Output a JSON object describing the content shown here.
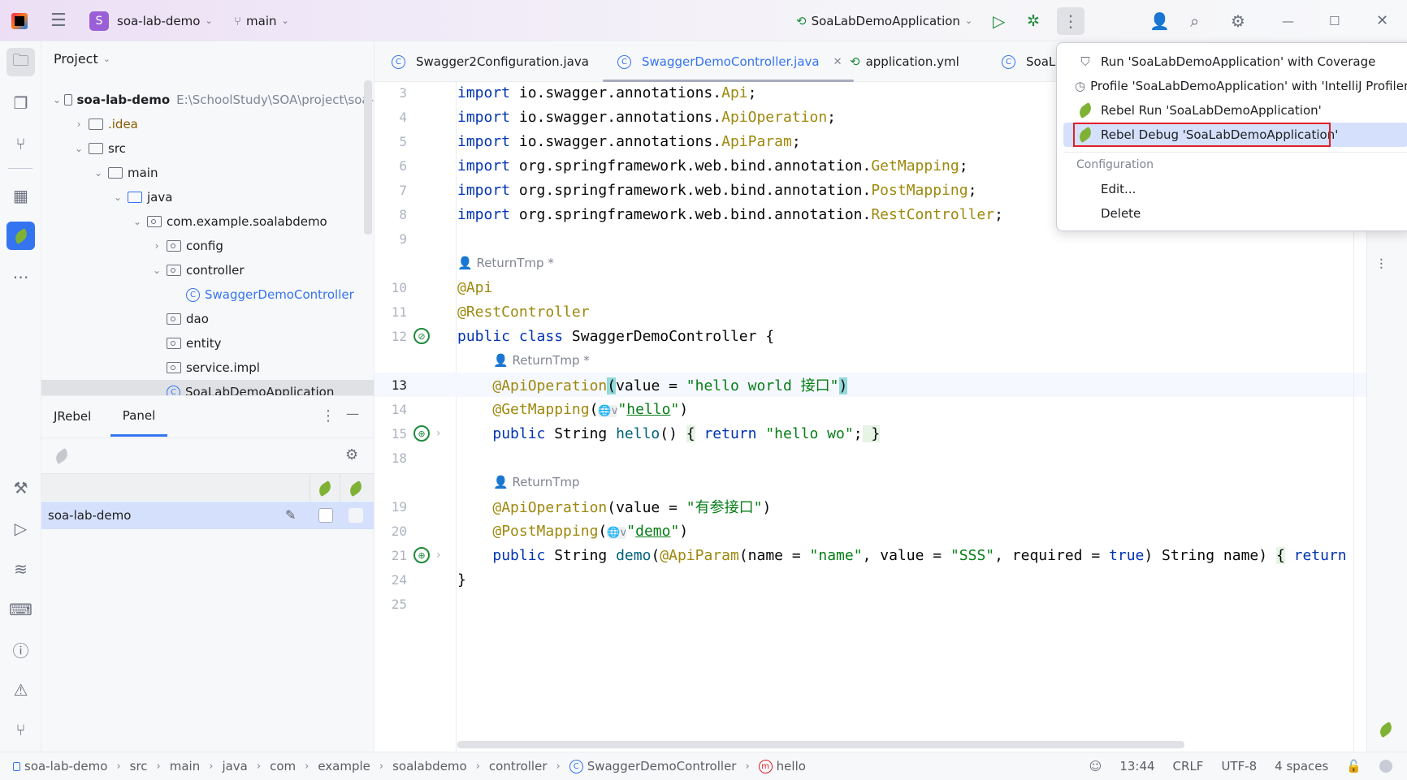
{
  "titlebar": {
    "project_initial": "S",
    "project_name": "soa-lab-demo",
    "branch": "main",
    "run_config": "SoaLabDemoApplication",
    "project_color": "#9a5fd6"
  },
  "project_panel": {
    "title": "Project",
    "tree": [
      {
        "label": "soa-lab-demo",
        "path": "E:\\SchoolStudy\\SOA\\project\\soa-",
        "depth": 0,
        "chev": "v",
        "icon": "module",
        "bold": true
      },
      {
        "label": ".idea",
        "depth": 1,
        "chev": ">",
        "icon": "folder",
        "color": "#8a5a00"
      },
      {
        "label": "src",
        "depth": 1,
        "chev": "v",
        "icon": "folder"
      },
      {
        "label": "main",
        "depth": 2,
        "chev": "v",
        "icon": "folder"
      },
      {
        "label": "java",
        "depth": 3,
        "chev": "v",
        "icon": "folder-blue"
      },
      {
        "label": "com.example.soalabdemo",
        "depth": 4,
        "chev": "v",
        "icon": "package"
      },
      {
        "label": "config",
        "depth": 5,
        "chev": ">",
        "icon": "package"
      },
      {
        "label": "controller",
        "depth": 5,
        "chev": "v",
        "icon": "package"
      },
      {
        "label": "SwaggerDemoController",
        "depth": 6,
        "chev": "",
        "icon": "class",
        "color": "#3574f0"
      },
      {
        "label": "dao",
        "depth": 5,
        "chev": "",
        "icon": "package"
      },
      {
        "label": "entity",
        "depth": 5,
        "chev": "",
        "icon": "package"
      },
      {
        "label": "service.impl",
        "depth": 5,
        "chev": "",
        "icon": "package"
      },
      {
        "label": "SoaLabDemoApplication",
        "depth": 5,
        "chev": "",
        "icon": "class"
      }
    ]
  },
  "jrebel_panel": {
    "tabs": [
      "JRebel",
      "Panel"
    ],
    "active_tab": "Panel",
    "row": {
      "name": "soa-lab-demo",
      "jrebel_enabled": false,
      "remote_enabled": false
    }
  },
  "editor": {
    "tabs": [
      {
        "label": "Swagger2Configuration.java",
        "active": false
      },
      {
        "label": "SwaggerDemoController.java",
        "active": true,
        "closable": true
      },
      {
        "label": "application.yml",
        "active": false
      },
      {
        "label": "SoaLa",
        "active": false
      }
    ],
    "lines": [
      {
        "n": "3",
        "t": [
          [
            "import ",
            "kw"
          ],
          [
            "io.swagger.annotations.",
            "pl"
          ],
          [
            "Api",
            "an"
          ],
          [
            ";",
            "pl"
          ]
        ]
      },
      {
        "n": "4",
        "t": [
          [
            "import ",
            "kw"
          ],
          [
            "io.swagger.annotations.",
            "pl"
          ],
          [
            "ApiOperation",
            "an"
          ],
          [
            ";",
            "pl"
          ]
        ]
      },
      {
        "n": "5",
        "t": [
          [
            "import ",
            "kw"
          ],
          [
            "io.swagger.annotations.",
            "pl"
          ],
          [
            "ApiParam",
            "an"
          ],
          [
            ";",
            "pl"
          ]
        ]
      },
      {
        "n": "6",
        "t": [
          [
            "import ",
            "kw"
          ],
          [
            "org.springframework.web.bind.annotation.",
            "pl"
          ],
          [
            "GetMapping",
            "an"
          ],
          [
            ";",
            "pl"
          ]
        ]
      },
      {
        "n": "7",
        "t": [
          [
            "import ",
            "kw"
          ],
          [
            "org.springframework.web.bind.annotation.",
            "pl"
          ],
          [
            "PostMapping",
            "an"
          ],
          [
            ";",
            "pl"
          ]
        ]
      },
      {
        "n": "8",
        "t": [
          [
            "import ",
            "kw"
          ],
          [
            "org.springframework.web.bind.annotation.",
            "pl"
          ],
          [
            "RestController",
            "an"
          ],
          [
            ";",
            "pl"
          ]
        ]
      },
      {
        "n": "9",
        "t": []
      },
      {
        "inlay": "ReturnTmp *",
        "indent": 0
      },
      {
        "n": "10",
        "t": [
          [
            "@Api",
            "an"
          ]
        ]
      },
      {
        "n": "11",
        "t": [
          [
            "@RestController",
            "an"
          ]
        ]
      },
      {
        "n": "12",
        "gutter": "bean",
        "t": [
          [
            "public class ",
            "kw"
          ],
          [
            "SwaggerDemoController ",
            "pl"
          ],
          [
            "{",
            "pl"
          ]
        ]
      },
      {
        "inlay": "ReturnTmp *",
        "indent": 1
      },
      {
        "n": "13",
        "current": true,
        "t": [
          [
            "    ",
            "pl"
          ],
          [
            "@ApiOperation",
            "an"
          ],
          [
            "(",
            "pl br"
          ],
          [
            "value = ",
            "pl"
          ],
          [
            "\"hello world 接口\"",
            "st"
          ],
          [
            ")",
            "pl br"
          ]
        ]
      },
      {
        "n": "14",
        "t": [
          [
            "    ",
            "pl"
          ],
          [
            "@GetMapping",
            "an"
          ],
          [
            "(",
            "pl"
          ],
          [
            "🌐v",
            "pl"
          ],
          [
            "\"",
            "st"
          ],
          [
            "hello",
            "st ul"
          ],
          [
            "\"",
            "st"
          ],
          [
            ")",
            "pl"
          ]
        ]
      },
      {
        "n": "15",
        "gutter": "web",
        "fold": true,
        "t": [
          [
            "    ",
            "pl"
          ],
          [
            "public ",
            "kw"
          ],
          [
            "String ",
            "pl"
          ],
          [
            "hello",
            "fn"
          ],
          [
            "() ",
            "pl"
          ],
          [
            "{",
            "pl fold"
          ],
          [
            " return ",
            "kw"
          ],
          [
            "\"hello wo\"",
            "st"
          ],
          [
            ";",
            "pl"
          ],
          [
            " }",
            "pl fold"
          ]
        ]
      },
      {
        "n": "18",
        "t": []
      },
      {
        "inlay": "ReturnTmp",
        "indent": 1
      },
      {
        "n": "19",
        "t": [
          [
            "    ",
            "pl"
          ],
          [
            "@ApiOperation",
            "an"
          ],
          [
            "(value = ",
            "pl"
          ],
          [
            "\"有参接口\"",
            "st"
          ],
          [
            ")",
            "pl"
          ]
        ]
      },
      {
        "n": "20",
        "t": [
          [
            "    ",
            "pl"
          ],
          [
            "@PostMapping",
            "an"
          ],
          [
            "(",
            "pl"
          ],
          [
            "🌐v",
            "pl"
          ],
          [
            "\"",
            "st"
          ],
          [
            "demo",
            "st ul"
          ],
          [
            "\"",
            "st"
          ],
          [
            ")",
            "pl"
          ]
        ]
      },
      {
        "n": "21",
        "gutter": "web",
        "fold": true,
        "t": [
          [
            "    ",
            "pl"
          ],
          [
            "public ",
            "kw"
          ],
          [
            "String ",
            "pl"
          ],
          [
            "demo",
            "fn"
          ],
          [
            "(",
            "pl"
          ],
          [
            "@ApiParam",
            "an"
          ],
          [
            "(name = ",
            "pl"
          ],
          [
            "\"name\"",
            "st"
          ],
          [
            ", value = ",
            "pl"
          ],
          [
            "\"SSS\"",
            "st"
          ],
          [
            ", required = ",
            "pl"
          ],
          [
            "true",
            "kw"
          ],
          [
            ") String name) ",
            "pl"
          ],
          [
            "{",
            "pl fold"
          ],
          [
            " return",
            "kw"
          ]
        ]
      },
      {
        "n": "24",
        "t": [
          [
            "}",
            "pl"
          ]
        ]
      },
      {
        "n": "25",
        "t": []
      }
    ]
  },
  "popup": {
    "items": [
      {
        "label": "Run 'SoaLabDemoApplication' with Coverage",
        "icon": "coverage-icon"
      },
      {
        "label": "Profile 'SoaLabDemoApplication' with 'IntelliJ Profiler'",
        "icon": "profiler-icon"
      },
      {
        "label": "Rebel Run 'SoaLabDemoApplication'",
        "icon": "jrebel-run-icon"
      },
      {
        "label": "Rebel Debug 'SoaLabDemoApplication'",
        "icon": "jrebel-debug-icon",
        "selected": true
      }
    ],
    "section": "Configuration",
    "config_items": [
      "Edit...",
      "Delete"
    ]
  },
  "statusbar": {
    "breadcrumbs": [
      "soa-lab-demo",
      "src",
      "main",
      "java",
      "com",
      "example",
      "soalabdemo",
      "controller",
      "SwaggerDemoController",
      "hello"
    ],
    "position": "13:44",
    "line_sep": "CRLF",
    "encoding": "UTF-8",
    "indent": "4 spaces"
  }
}
